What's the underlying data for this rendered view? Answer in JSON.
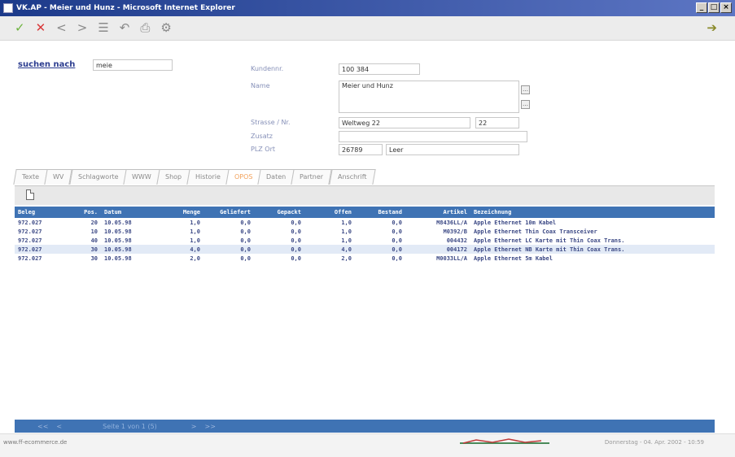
{
  "window": {
    "title": "VK.AP - Meier und Hunz - Microsoft Internet Explorer"
  },
  "toolbar": {
    "icons": [
      "check-icon",
      "close-icon",
      "prev-icon",
      "next-icon",
      "list-icon",
      "undo-icon",
      "print-icon",
      "settings-icon",
      "exit-icon"
    ]
  },
  "search": {
    "label": "suchen nach",
    "value": "meie"
  },
  "customer": {
    "kundennr_label": "Kundennr.",
    "kundennr_value": "100 384",
    "name_label": "Name",
    "name_value": "Meier und Hunz",
    "strasse_label": "Strasse / Nr.",
    "strasse_value": "Weltweg 22",
    "strasse_nr": "22",
    "zusatz_label": "Zusatz",
    "zusatz_value": "",
    "plz_label": "PLZ Ort",
    "plz_value": "26789",
    "ort_value": "Leer"
  },
  "tabs": [
    {
      "label": "Texte"
    },
    {
      "label": "WV"
    },
    {
      "label": "Schlagworte"
    },
    {
      "label": "WWW"
    },
    {
      "label": "Shop"
    },
    {
      "label": "Historie"
    },
    {
      "label": "OPOS"
    },
    {
      "label": "Daten"
    },
    {
      "label": "Partner"
    },
    {
      "label": "Anschrift"
    }
  ],
  "table": {
    "headers": [
      "Beleg",
      "Pos.",
      "Datum",
      "Menge",
      "Geliefert",
      "Gepackt",
      "Offen",
      "Bestand",
      "Artikel",
      "Bezeichnung"
    ],
    "rows": [
      [
        "972.027",
        "20",
        "10.05.98",
        "1,0",
        "0,0",
        "0,0",
        "1,0",
        "0,0",
        "M8436LL/A",
        "Apple Ethernet 10m Kabel"
      ],
      [
        "972.027",
        "10",
        "10.05.98",
        "1,0",
        "0,0",
        "0,0",
        "1,0",
        "0,0",
        "M0392/B",
        "Apple Ethernet Thin Coax Transceiver"
      ],
      [
        "972.027",
        "40",
        "10.05.98",
        "1,0",
        "0,0",
        "0,0",
        "1,0",
        "0,0",
        "004432",
        "Apple Ethernet LC Karte mit Thin Coax Trans."
      ],
      [
        "972.027",
        "30",
        "10.05.98",
        "4,0",
        "0,0",
        "0,0",
        "4,0",
        "0,0",
        "004172",
        "Apple Ethernet NB Karte mit Thin Coax Trans."
      ],
      [
        "972.027",
        "30",
        "10.05.98",
        "2,0",
        "0,0",
        "0,0",
        "2,0",
        "0,0",
        "M0033LL/A",
        "Apple Ethernet 5m Kabel"
      ]
    ]
  },
  "pager": {
    "first": "<<",
    "prev": "<",
    "info": "Seite 1 von 1 (5)",
    "next": ">",
    "last": ">>"
  },
  "status": {
    "url": "www.ff-ecommerce.de",
    "date": "Donnerstag - 04. Apr. 2002 - 10:59"
  }
}
